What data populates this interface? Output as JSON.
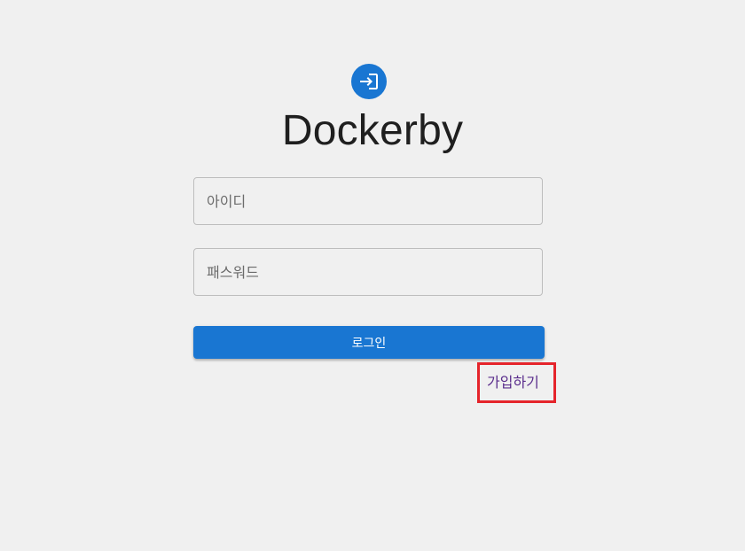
{
  "app": {
    "title": "Dockerby",
    "logo_icon": "login-icon",
    "accent_color": "#1976d2"
  },
  "form": {
    "username_placeholder": "아이디",
    "password_placeholder": "패스워드",
    "login_label": "로그인",
    "signup_label": "가입하기"
  },
  "highlight": {
    "color": "#e5242b"
  }
}
